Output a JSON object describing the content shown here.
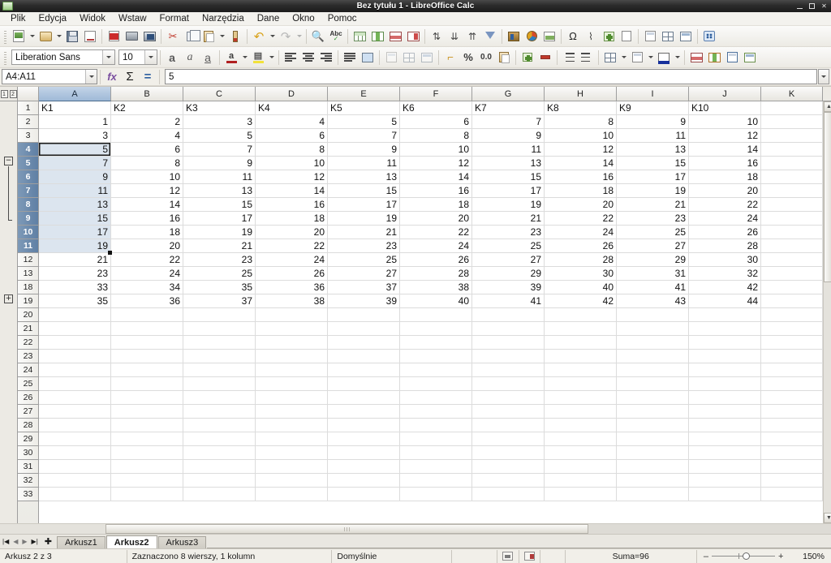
{
  "window": {
    "title": "Bez tytułu 1 - LibreOffice Calc",
    "app_icon": "calc-document-icon",
    "minimize": "–",
    "maximize": "□",
    "close": "✕"
  },
  "menubar": {
    "items": [
      {
        "label": "Plik"
      },
      {
        "label": "Edycja"
      },
      {
        "label": "Widok"
      },
      {
        "label": "Wstaw"
      },
      {
        "label": "Format"
      },
      {
        "label": "Narzędzia"
      },
      {
        "label": "Dane"
      },
      {
        "label": "Okno"
      },
      {
        "label": "Pomoc"
      }
    ]
  },
  "standard_toolbar": {
    "buttons": [
      "new-document-icon",
      "open-file-icon",
      "save-icon",
      "export-pdf-icon",
      "export-directly-as-pdf-icon",
      "print-icon",
      "print-preview-icon",
      "cut-icon",
      "copy-icon",
      "paste-icon",
      "clone-formatting-icon",
      "undo-icon",
      "redo-icon",
      "find-and-replace-icon",
      "spelling-icon",
      "sort-table-icon",
      "sort-ascending-table-icon",
      "sort-descending-table-icon",
      "autofilter-table-icon",
      "sort-icon",
      "sort-descending-icon",
      "sort-ascending-icon",
      "autofilter-funnel-icon",
      "insert-image-icon",
      "insert-chart-icon",
      "insert-draw-functions-icon",
      "special-character-icon",
      "insert-hyperlink-icon",
      "insert-comment-icon",
      "headers-and-footers-icon",
      "freeze-rows-columns-icon",
      "split-window-icon",
      "show-draw-functions-icon",
      "helplines-icon"
    ]
  },
  "formatting_toolbar": {
    "font_name": "Liberation Sans",
    "font_size": "10",
    "bold": "a",
    "italic": "a",
    "underline": "a",
    "font_color": "font-color-icon",
    "highlight_color": "highlighting-color-icon",
    "align_left": "align-left-icon",
    "align_center": "align-center-icon",
    "align_right": "align-right-icon",
    "align_justified": "align-justified-icon",
    "merge_cells": "merge-cells-icon",
    "align_top": "align-top-icon",
    "align_middle": "align-center-vertically-icon",
    "align_bottom": "align-bottom-icon",
    "currency": "format-as-currency-icon",
    "percent": "%",
    "number_format": "0.0",
    "date_format": "format-as-date-icon",
    "add_decimal": "add-decimal-place-icon",
    "delete_decimal": "delete-decimal-place-icon",
    "increase_indent": "increase-indent-icon",
    "decrease_indent": "decrease-indent-icon",
    "borders": "borders-icon",
    "border_style": "border-style-icon",
    "background_color": "background-color-icon",
    "conditional_1": "conditional-formatting-icon",
    "conditional_2": "conditional-format-manage-icon",
    "conditional_3": "data-styles-icon",
    "conditional_4": "styles-icon",
    "font_color_bar": "#b02020",
    "highlight_color_bar": "#f2e23a"
  },
  "formula_bar": {
    "name_box_value": "A4:A11",
    "function_wizard": "fx",
    "sum_icon": "Σ",
    "equals_icon": "=",
    "input_line_value": "5",
    "dropdown_icon": "chevron-down-icon"
  },
  "sheet": {
    "outline_levels": [
      "1",
      "2"
    ],
    "outline_collapse_label": "−",
    "outline_expand_label": "+",
    "column_headers": [
      "A",
      "B",
      "C",
      "D",
      "E",
      "F",
      "G",
      "H",
      "I",
      "J",
      "K"
    ],
    "selected_column": "A",
    "header_row": {
      "row_number": "1",
      "values": [
        "K1",
        "K2",
        "K3",
        "K4",
        "K5",
        "K6",
        "K7",
        "K8",
        "K9",
        "K10",
        ""
      ]
    },
    "data_rows": [
      {
        "row_number": "2",
        "selected": false,
        "values": [
          "1",
          "2",
          "3",
          "4",
          "5",
          "6",
          "7",
          "8",
          "9",
          "10",
          ""
        ]
      },
      {
        "row_number": "3",
        "selected": false,
        "values": [
          "3",
          "4",
          "5",
          "6",
          "7",
          "8",
          "9",
          "10",
          "11",
          "12",
          ""
        ]
      },
      {
        "row_number": "4",
        "selected": true,
        "cursor": true,
        "values": [
          "5",
          "6",
          "7",
          "8",
          "9",
          "10",
          "11",
          "12",
          "13",
          "14",
          ""
        ]
      },
      {
        "row_number": "5",
        "selected": true,
        "values": [
          "7",
          "8",
          "9",
          "10",
          "11",
          "12",
          "13",
          "14",
          "15",
          "16",
          ""
        ]
      },
      {
        "row_number": "6",
        "selected": true,
        "values": [
          "9",
          "10",
          "11",
          "12",
          "13",
          "14",
          "15",
          "16",
          "17",
          "18",
          ""
        ]
      },
      {
        "row_number": "7",
        "selected": true,
        "values": [
          "11",
          "12",
          "13",
          "14",
          "15",
          "16",
          "17",
          "18",
          "19",
          "20",
          ""
        ]
      },
      {
        "row_number": "8",
        "selected": true,
        "values": [
          "13",
          "14",
          "15",
          "16",
          "17",
          "18",
          "19",
          "20",
          "21",
          "22",
          ""
        ]
      },
      {
        "row_number": "9",
        "selected": true,
        "values": [
          "15",
          "16",
          "17",
          "18",
          "19",
          "20",
          "21",
          "22",
          "23",
          "24",
          ""
        ]
      },
      {
        "row_number": "10",
        "selected": true,
        "values": [
          "17",
          "18",
          "19",
          "20",
          "21",
          "22",
          "23",
          "24",
          "25",
          "26",
          ""
        ]
      },
      {
        "row_number": "11",
        "selected": true,
        "values": [
          "19",
          "20",
          "21",
          "22",
          "23",
          "24",
          "25",
          "26",
          "27",
          "28",
          ""
        ]
      },
      {
        "row_number": "12",
        "selected": false,
        "values": [
          "21",
          "22",
          "23",
          "24",
          "25",
          "26",
          "27",
          "28",
          "29",
          "30",
          ""
        ]
      },
      {
        "row_number": "13",
        "selected": false,
        "values": [
          "23",
          "24",
          "25",
          "26",
          "27",
          "28",
          "29",
          "30",
          "31",
          "32",
          ""
        ]
      },
      {
        "row_number": "18",
        "selected": false,
        "values": [
          "33",
          "34",
          "35",
          "36",
          "37",
          "38",
          "39",
          "40",
          "41",
          "42",
          ""
        ]
      },
      {
        "row_number": "19",
        "selected": false,
        "values": [
          "35",
          "36",
          "37",
          "38",
          "39",
          "40",
          "41",
          "42",
          "43",
          "44",
          ""
        ]
      },
      {
        "row_number": "20",
        "selected": false,
        "values": [
          "",
          "",
          "",
          "",
          "",
          "",
          "",
          "",
          "",
          "",
          ""
        ]
      },
      {
        "row_number": "21",
        "selected": false,
        "values": [
          "",
          "",
          "",
          "",
          "",
          "",
          "",
          "",
          "",
          "",
          ""
        ]
      },
      {
        "row_number": "22",
        "selected": false,
        "values": [
          "",
          "",
          "",
          "",
          "",
          "",
          "",
          "",
          "",
          "",
          ""
        ]
      },
      {
        "row_number": "23",
        "selected": false,
        "values": [
          "",
          "",
          "",
          "",
          "",
          "",
          "",
          "",
          "",
          "",
          ""
        ]
      },
      {
        "row_number": "24",
        "selected": false,
        "values": [
          "",
          "",
          "",
          "",
          "",
          "",
          "",
          "",
          "",
          "",
          ""
        ]
      },
      {
        "row_number": "25",
        "selected": false,
        "values": [
          "",
          "",
          "",
          "",
          "",
          "",
          "",
          "",
          "",
          "",
          ""
        ]
      },
      {
        "row_number": "26",
        "selected": false,
        "values": [
          "",
          "",
          "",
          "",
          "",
          "",
          "",
          "",
          "",
          "",
          ""
        ]
      },
      {
        "row_number": "27",
        "selected": false,
        "values": [
          "",
          "",
          "",
          "",
          "",
          "",
          "",
          "",
          "",
          "",
          ""
        ]
      },
      {
        "row_number": "28",
        "selected": false,
        "values": [
          "",
          "",
          "",
          "",
          "",
          "",
          "",
          "",
          "",
          "",
          ""
        ]
      },
      {
        "row_number": "29",
        "selected": false,
        "values": [
          "",
          "",
          "",
          "",
          "",
          "",
          "",
          "",
          "",
          "",
          ""
        ]
      },
      {
        "row_number": "30",
        "selected": false,
        "values": [
          "",
          "",
          "",
          "",
          "",
          "",
          "",
          "",
          "",
          "",
          ""
        ]
      },
      {
        "row_number": "31",
        "selected": false,
        "values": [
          "",
          "",
          "",
          "",
          "",
          "",
          "",
          "",
          "",
          "",
          ""
        ]
      },
      {
        "row_number": "32",
        "selected": false,
        "values": [
          "",
          "",
          "",
          "",
          "",
          "",
          "",
          "",
          "",
          "",
          ""
        ]
      },
      {
        "row_number": "33",
        "selected": false,
        "values": [
          "",
          "",
          "",
          "",
          "",
          "",
          "",
          "",
          "",
          "",
          ""
        ]
      }
    ]
  },
  "sheet_tabs": {
    "first_icon": "first-sheet-icon",
    "prev_icon": "previous-sheet-icon",
    "next_icon": "next-sheet-icon",
    "last_icon": "last-sheet-icon",
    "add_icon": "add-sheet-icon",
    "tabs": [
      {
        "label": "Arkusz1",
        "active": false
      },
      {
        "label": "Arkusz2",
        "active": true
      },
      {
        "label": "Arkusz3",
        "active": false
      }
    ]
  },
  "statusbar": {
    "sheet_info": "Arkusz 2 z 3",
    "selection_info": "Zaznaczono 8 wierszy, 1 kolumn",
    "page_style": "Domyślnie",
    "insert_mode": "",
    "selection_mode_icon": "selection-mode-icon",
    "modified_icon": "document-modified-icon",
    "signature": "",
    "sum_info": "Suma=96",
    "zoom_minus": "–",
    "zoom_plus": "+",
    "zoom_level": "150%"
  },
  "colors": {
    "selection_fill": "#dce5ef",
    "header_selected": "#5f7fa4",
    "column_header_selected": "#9fb9d7",
    "titlebar": "#1c1c1c"
  }
}
